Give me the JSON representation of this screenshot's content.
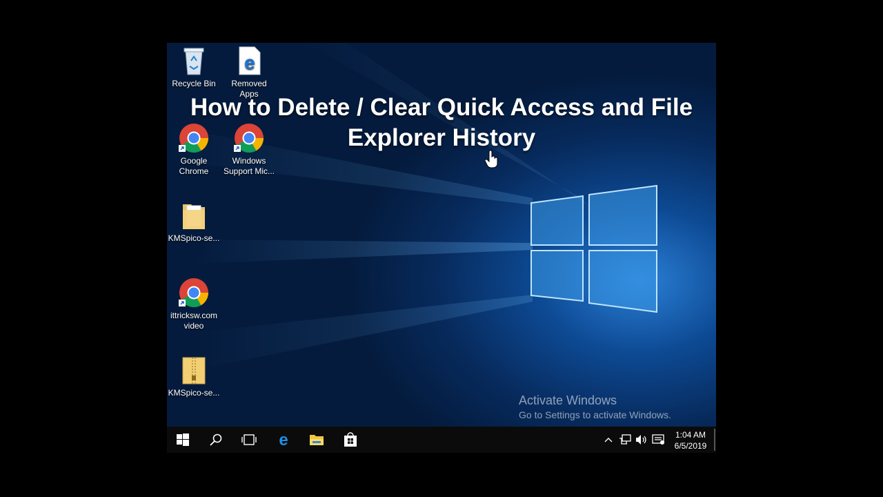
{
  "desktop": {
    "icons": [
      {
        "label_line1": "Recycle Bin",
        "label_line2": "",
        "icon": "recycle-bin-icon"
      },
      {
        "label_line1": "Removed",
        "label_line2": "Apps",
        "icon": "edge-file-icon"
      },
      {
        "label_line1": "Google",
        "label_line2": "Chrome",
        "icon": "chrome-icon"
      },
      {
        "label_line1": "Windows",
        "label_line2": "Support Mic...",
        "icon": "chrome-icon"
      },
      {
        "label_line1": "KMSpico-se...",
        "label_line2": "",
        "icon": "folder-icon"
      },
      {
        "label_line1": "ittricksw.com",
        "label_line2": "video",
        "icon": "chrome-icon"
      },
      {
        "label_line1": "KMSpico-se...",
        "label_line2": "",
        "icon": "zip-folder-icon"
      }
    ]
  },
  "overlay_title": {
    "line1": "How to Delete / Clear Quick Access and File",
    "line2": "Explorer History"
  },
  "watermark": {
    "title": "Activate Windows",
    "subtitle": "Go to Settings to activate Windows."
  },
  "taskbar": {
    "buttons": [
      "start-icon",
      "search-icon",
      "task-view-icon",
      "edge-icon",
      "file-explorer-icon",
      "store-icon"
    ],
    "tray": [
      "chevron-up-icon",
      "network-icon",
      "volume-icon",
      "action-center-icon"
    ],
    "clock": {
      "time": "1:04 AM",
      "date": "6/5/2019"
    }
  },
  "colors": {
    "accent": "#0078d7",
    "taskbar": "#0b0b0c"
  }
}
